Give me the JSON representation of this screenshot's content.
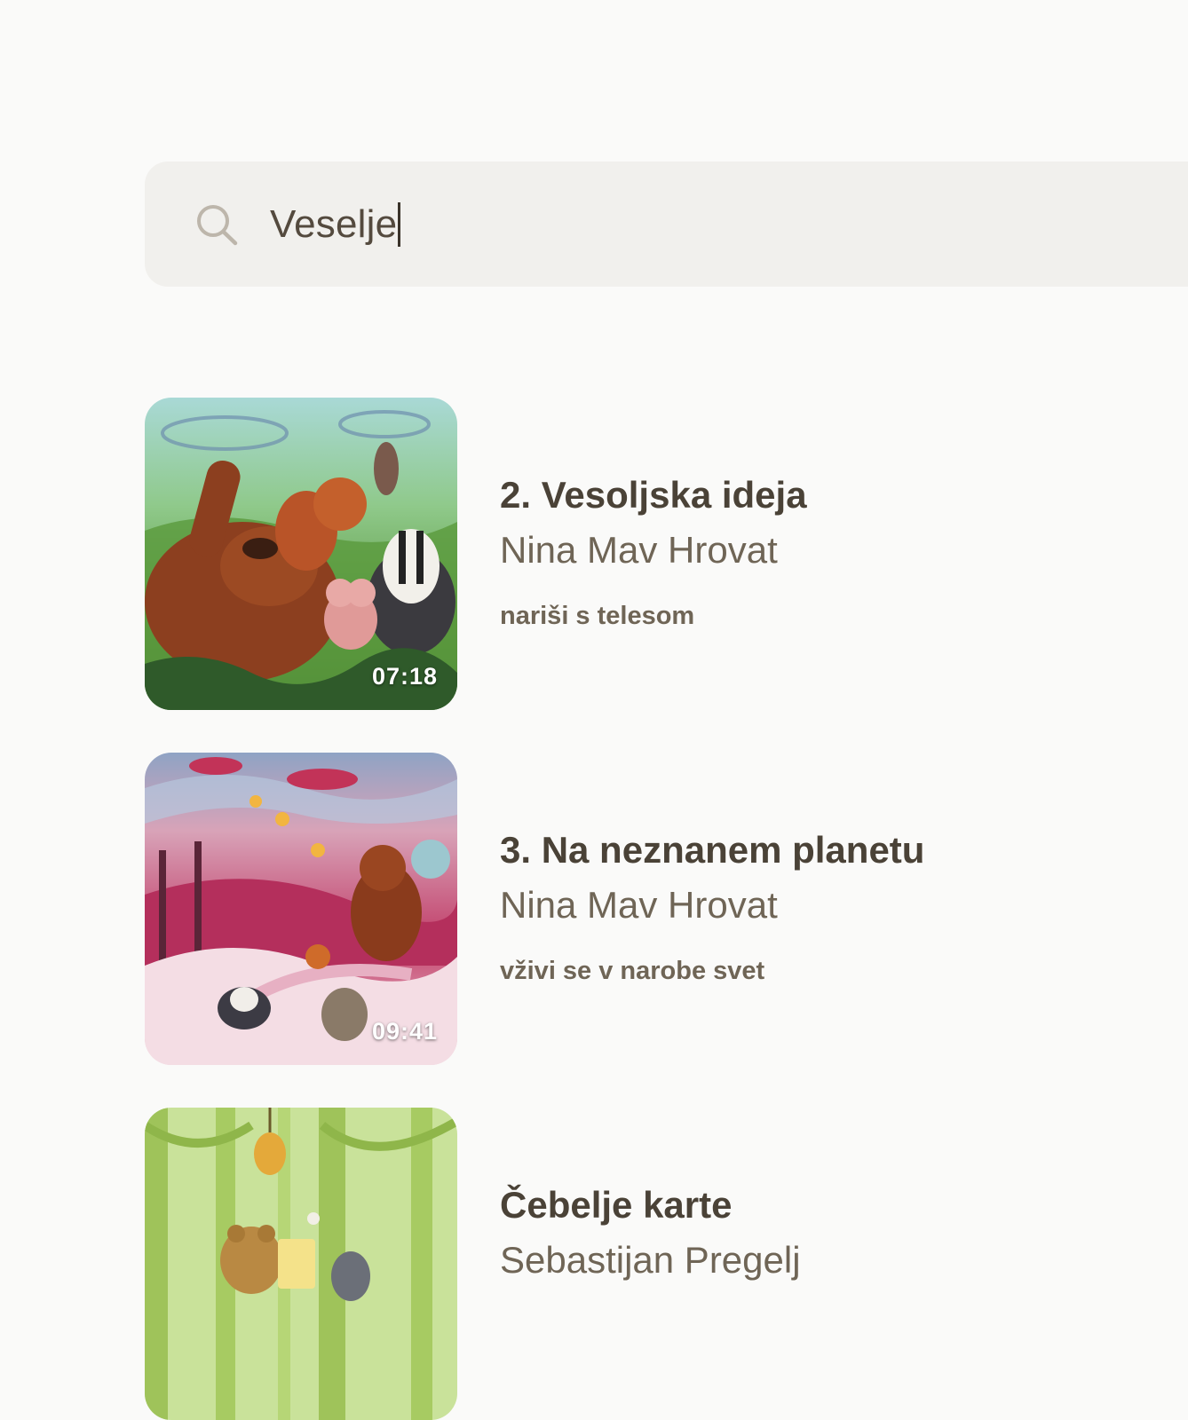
{
  "search": {
    "value": "Veselje",
    "icon": "search-icon"
  },
  "results": [
    {
      "title": "2. Vesoljska ideja",
      "author": "Nina Mav Hrovat",
      "subtitle": "nariši s telesom",
      "duration": "07:18"
    },
    {
      "title": "3. Na neznanem planetu",
      "author": "Nina Mav Hrovat",
      "subtitle": "vživi se v narobe svet",
      "duration": "09:41"
    },
    {
      "title": "Čebelje karte",
      "author": "Sebastijan Pregelj"
    }
  ]
}
